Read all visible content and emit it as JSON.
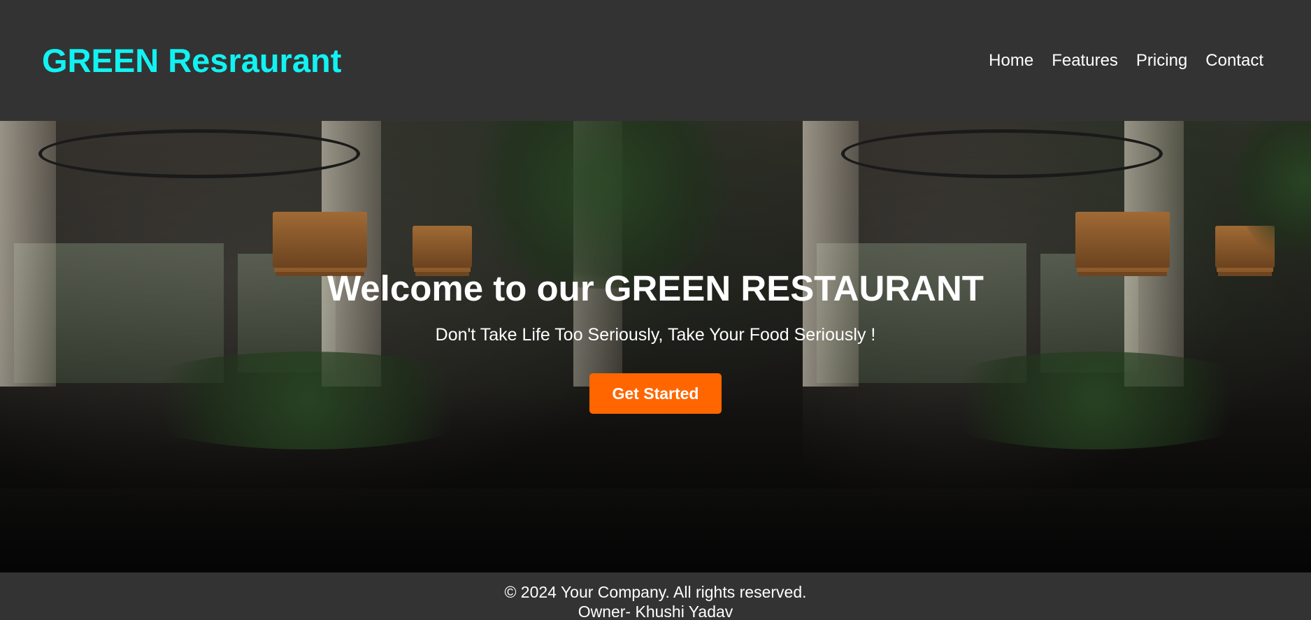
{
  "header": {
    "logo": "GREEN Resraurant",
    "nav": [
      {
        "label": "Home"
      },
      {
        "label": "Features"
      },
      {
        "label": "Pricing"
      },
      {
        "label": "Contact"
      }
    ]
  },
  "hero": {
    "title": "Welcome to our GREEN RESTAURANT",
    "subtitle": "Don't Take Life Too Seriously, Take Your Food Seriously !",
    "cta_label": "Get Started",
    "background": "restaurant-interior-photo"
  },
  "footer": {
    "copyright": "© 2024 Your Company. All rights reserved.",
    "owner": "Owner- Khushi Yadav"
  },
  "colors": {
    "header_bg": "#333333",
    "logo": "#12f2f2",
    "cta": "#ff6600",
    "text": "#ffffff"
  }
}
